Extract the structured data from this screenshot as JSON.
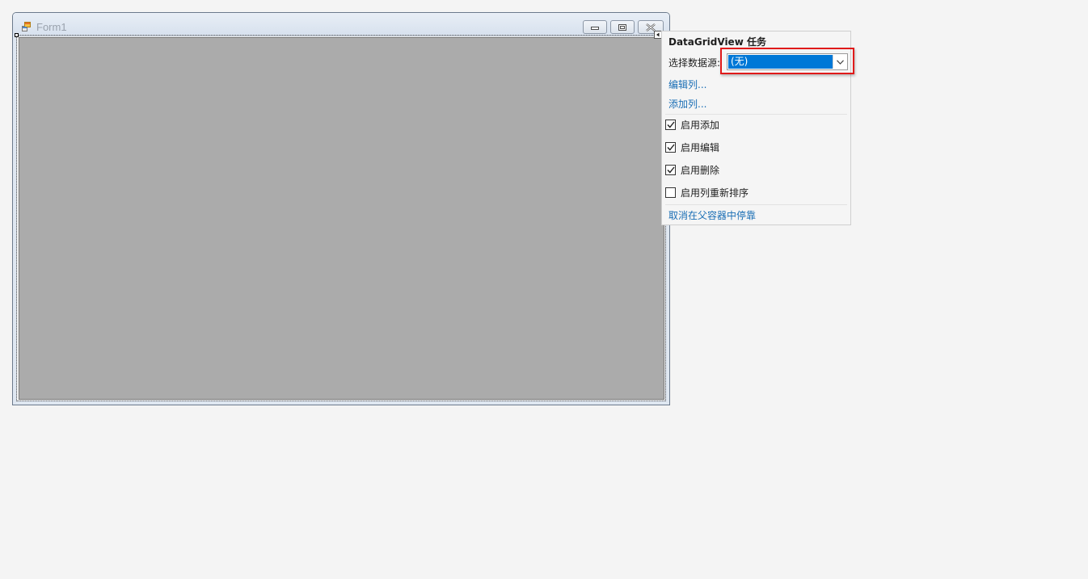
{
  "form": {
    "title": "Form1"
  },
  "tasks_panel": {
    "header": "DataGridView 任务",
    "datasource_label": "选择数据源:",
    "datasource_value": "(无)",
    "edit_columns": "编辑列...",
    "add_column": "添加列...",
    "checkboxes": [
      {
        "label": "启用添加",
        "checked": true
      },
      {
        "label": "启用编辑",
        "checked": true
      },
      {
        "label": "启用删除",
        "checked": true
      },
      {
        "label": "启用列重新排序",
        "checked": false
      }
    ],
    "undock_link": "取消在父容器中停靠"
  },
  "colors": {
    "grid_background": "#ababab",
    "selected_value_bg": "#0078d7",
    "link": "#1a6eb5",
    "highlight": "#e01a1a"
  }
}
